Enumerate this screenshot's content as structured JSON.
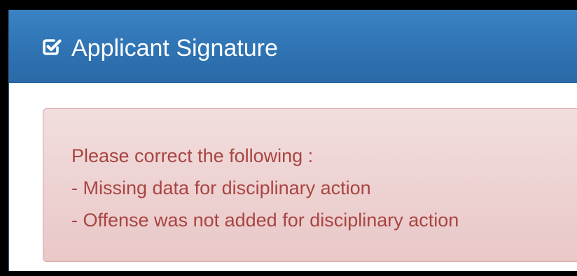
{
  "panel": {
    "icon": "checkbox-checked-icon",
    "title": "Applicant Signature"
  },
  "alert": {
    "intro": "Please correct the following :",
    "errors": [
      "- Missing data for disciplinary action",
      "- Offense was not added for disciplinary action"
    ]
  },
  "colors": {
    "heading_bg": "#337ab7",
    "alert_bg": "#f2dede",
    "alert_border": "#ebccd1",
    "alert_text": "#a94442"
  }
}
